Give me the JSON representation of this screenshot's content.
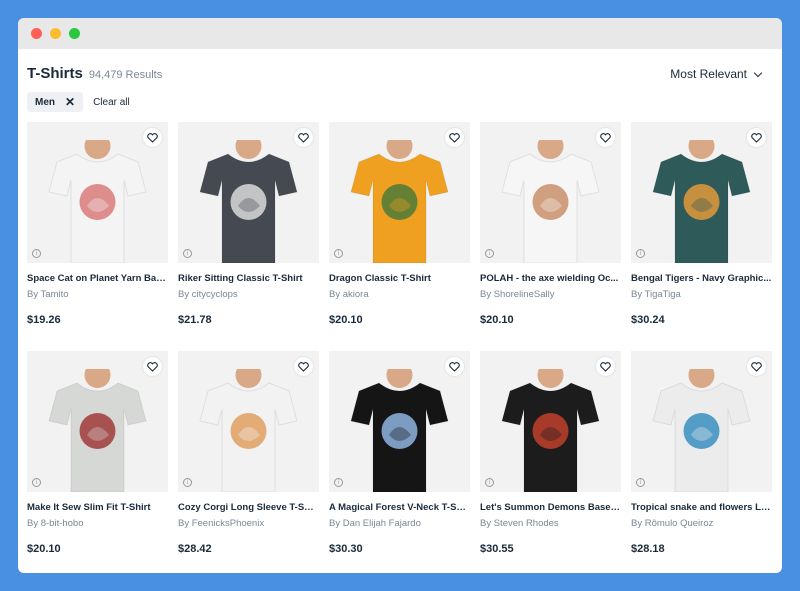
{
  "window": {
    "dots": [
      "#ff5f57",
      "#febc2e",
      "#28c840"
    ]
  },
  "header": {
    "title": "T-Shirts",
    "results": "94,479 Results",
    "sort_label": "Most Relevant"
  },
  "filters": {
    "chip_label": "Men",
    "clear_label": "Clear all"
  },
  "products": [
    {
      "name": "Space Cat on Planet Yarn Ball...",
      "artist": "By Tamito",
      "price": "$19.26",
      "shirt_color": "#f4f4f4",
      "accent": "#d97a7a"
    },
    {
      "name": "Riker Sitting Classic T-Shirt",
      "artist": "By citycyclops",
      "price": "$21.78",
      "shirt_color": "#454a52",
      "accent": "#d9d9d9"
    },
    {
      "name": "Dragon Classic T-Shirt",
      "artist": "By akiora",
      "price": "$20.10",
      "shirt_color": "#f0a020",
      "accent": "#4c7a3a"
    },
    {
      "name": "POLAH - the axe wielding Oc...",
      "artist": "By ShorelineSally",
      "price": "$20.10",
      "shirt_color": "#f6f6f6",
      "accent": "#c98f6a"
    },
    {
      "name": "Bengal Tigers - Navy Graphic...",
      "artist": "By TigaTiga",
      "price": "$30.24",
      "shirt_color": "#2f5a5a",
      "accent": "#e09a3a"
    },
    {
      "name": "Make It Sew Slim Fit T-Shirt",
      "artist": "By 8-bit-hobo",
      "price": "$20.10",
      "shirt_color": "#d6d8d6",
      "accent": "#a03a3a"
    },
    {
      "name": "Cozy Corgi Long Sleeve T-Shirt",
      "artist": "By FeenicksPhoenix",
      "price": "$28.42",
      "shirt_color": "#f2f2f2",
      "accent": "#e0a060"
    },
    {
      "name": "A Magical Forest V-Neck T-Sh...",
      "artist": "By Dan Elijah Fajardo",
      "price": "$30.30",
      "shirt_color": "#151515",
      "accent": "#8fb4e0"
    },
    {
      "name": "Let's Summon Demons Baseb...",
      "artist": "By Steven Rhodes",
      "price": "$30.55",
      "shirt_color": "#1c1c1c",
      "accent": "#c0402a"
    },
    {
      "name": "Tropical snake and flowers Lo...",
      "artist": "By Rômulo Queiroz",
      "price": "$28.18",
      "shirt_color": "#ececec",
      "accent": "#3a8fc0"
    }
  ]
}
